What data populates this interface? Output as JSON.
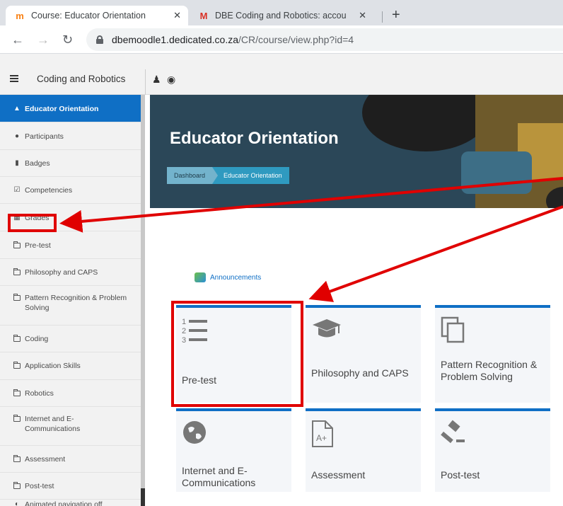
{
  "browser": {
    "tabs": [
      {
        "title": "Course: Educator Orientation",
        "favicon": "moodle-icon",
        "active": true
      },
      {
        "title": "DBE Coding and Robotics: accou",
        "favicon": "gmail-icon",
        "active": false
      }
    ],
    "close_glyph": "✕",
    "new_tab_glyph": "+",
    "url_host": "dbemoodle1.dedicated.co.za",
    "url_path": "/CR/course/view.php?id=4"
  },
  "moodle_nav": {
    "site_name": "Coding and Robotics"
  },
  "sidebar": {
    "items": [
      {
        "label": "Educator Orientation",
        "icon": "graduation-cap-icon",
        "active": true
      },
      {
        "label": "Participants",
        "icon": "users-icon"
      },
      {
        "label": "Badges",
        "icon": "shield-icon"
      },
      {
        "label": "Competencies",
        "icon": "check-square-icon"
      },
      {
        "label": "Grades",
        "icon": "table-icon"
      },
      {
        "label": "Pre-test",
        "icon": "folder-icon"
      },
      {
        "label": "Philosophy and CAPS",
        "icon": "folder-icon"
      },
      {
        "label": "Pattern Recognition & Problem Solving",
        "icon": "folder-icon"
      },
      {
        "label": "Coding",
        "icon": "folder-icon"
      },
      {
        "label": "Application Skills",
        "icon": "folder-icon"
      },
      {
        "label": "Robotics",
        "icon": "folder-icon"
      },
      {
        "label": "Internet and E-Communications",
        "icon": "folder-icon"
      },
      {
        "label": "Assessment",
        "icon": "folder-icon"
      },
      {
        "label": "Post-test",
        "icon": "folder-icon"
      },
      {
        "label": "Animated navigation off",
        "icon": "toggle-icon"
      }
    ]
  },
  "header": {
    "title": "Educator Orientation",
    "breadcrumb": [
      "Dashboard",
      "Educator Orientation"
    ]
  },
  "content": {
    "announcements_label": "Announcements",
    "tiles": [
      {
        "label": "Pre-test",
        "icon": "numbered-list-icon"
      },
      {
        "label": "Philosophy and CAPS",
        "icon": "graduation-cap-icon"
      },
      {
        "label": "Pattern Recognition & Problem Solving",
        "icon": "copy-icon"
      },
      {
        "label": "Internet and E-Communications",
        "icon": "globe-icon"
      },
      {
        "label": "Assessment",
        "icon": "grade-document-icon"
      },
      {
        "label": "Post-test",
        "icon": "gavel-icon"
      }
    ]
  },
  "colors": {
    "accent": "#0f6fc5",
    "highlight": "#e00000"
  }
}
